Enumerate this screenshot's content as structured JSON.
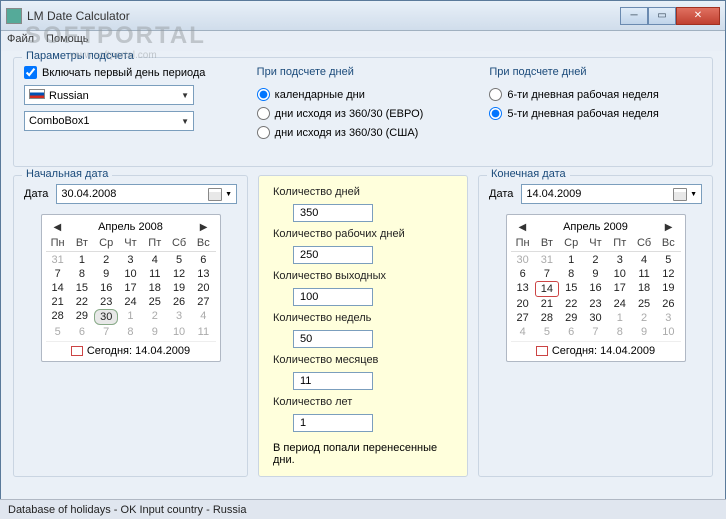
{
  "window": {
    "title": "LM Date Calculator"
  },
  "menu": {
    "file": "Файл",
    "help": "Помощь"
  },
  "watermark": {
    "main": "SOFTPORTAL",
    "sub": "www.softportal.com"
  },
  "params": {
    "title": "Параметры подсчета",
    "include_first_day": "Включать первый день периода",
    "language": "Russian",
    "combo2": "ComboBox1",
    "col2_title": "При подсчете дней",
    "col2_opt1": "календарные дни",
    "col2_opt2": "дни исходя из 360/30 (ЕВРО)",
    "col2_opt3": "дни исходя из 360/30 (США)",
    "col3_title": "При подсчете дней",
    "col3_opt1": "6-ти дневная рабочая неделя",
    "col3_opt2": "5-ти дневная рабочая неделя"
  },
  "start": {
    "title": "Начальная дата",
    "label": "Дата",
    "value": "30.04.2008",
    "month": "Апрель 2008",
    "today_label": "Сегодня: 14.04.2009"
  },
  "end": {
    "title": "Конечная дата",
    "label": "Дата",
    "value": "14.04.2009",
    "month": "Апрель 2009",
    "today_label": "Сегодня: 14.04.2009"
  },
  "dow": [
    "Пн",
    "Вт",
    "Ср",
    "Чт",
    "Пт",
    "Сб",
    "Вс"
  ],
  "calc": {
    "days_label": "Количество дней",
    "days": "350",
    "workdays_label": "Количество рабочих дней",
    "workdays": "250",
    "holidays_label": "Количество выходных",
    "holidays": "100",
    "weeks_label": "Количество недель",
    "weeks": "50",
    "months_label": "Количество месяцев",
    "months": "11",
    "years_label": "Количество лет",
    "years": "1",
    "note": "В период попали перенесенные дни."
  },
  "status": "Database of holidays - OK  Input country - Russia"
}
